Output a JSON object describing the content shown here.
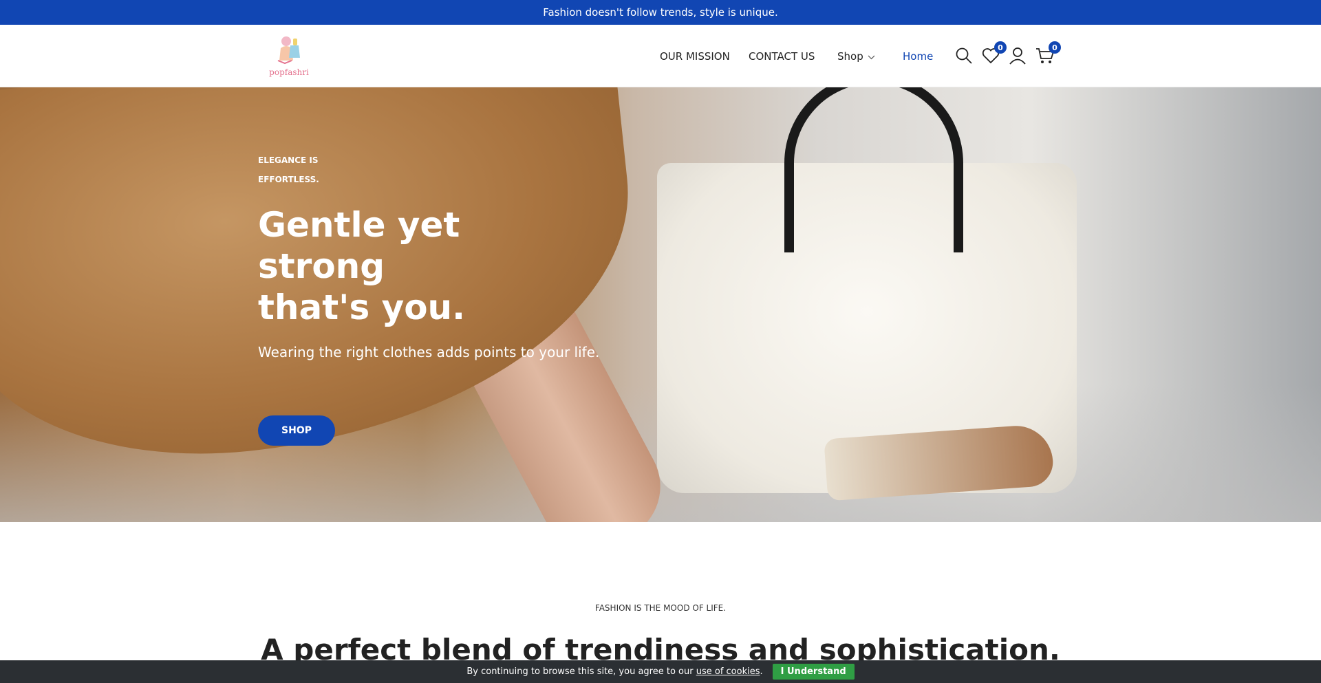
{
  "announcement": "Fashion doesn't follow trends, style is unique.",
  "header": {
    "logo_text": "popfashri",
    "nav": {
      "mission": "OUR MISSION",
      "contact": "CONTACT US",
      "shop": "Shop",
      "home": "Home"
    },
    "wishlist_count": "0",
    "cart_count": "0",
    "icons": [
      "search-icon",
      "heart-icon",
      "user-icon",
      "cart-icon",
      "chevron-down-icon"
    ]
  },
  "hero": {
    "eyebrow_line1": "ELEGANCE IS",
    "eyebrow_line2": "EFFORTLESS.",
    "title_line1": "Gentle yet",
    "title_line2": "strong",
    "title_line3": "that's you.",
    "subtitle": "Wearing the right clothes adds points to your life.",
    "button": "SHOP"
  },
  "section": {
    "eyebrow": "FASHION IS THE MOOD OF LIFE.",
    "title": "A perfect blend of trendiness and sophistication."
  },
  "cookie": {
    "text_before": "By continuing to browse this site, you agree to our",
    "link": "use of cookies",
    "text_after": ".",
    "button": "I Understand"
  },
  "colors": {
    "brand_blue": "#1146b3",
    "cookie_bg": "#2b2f33",
    "cookie_button": "#2f9e44"
  }
}
